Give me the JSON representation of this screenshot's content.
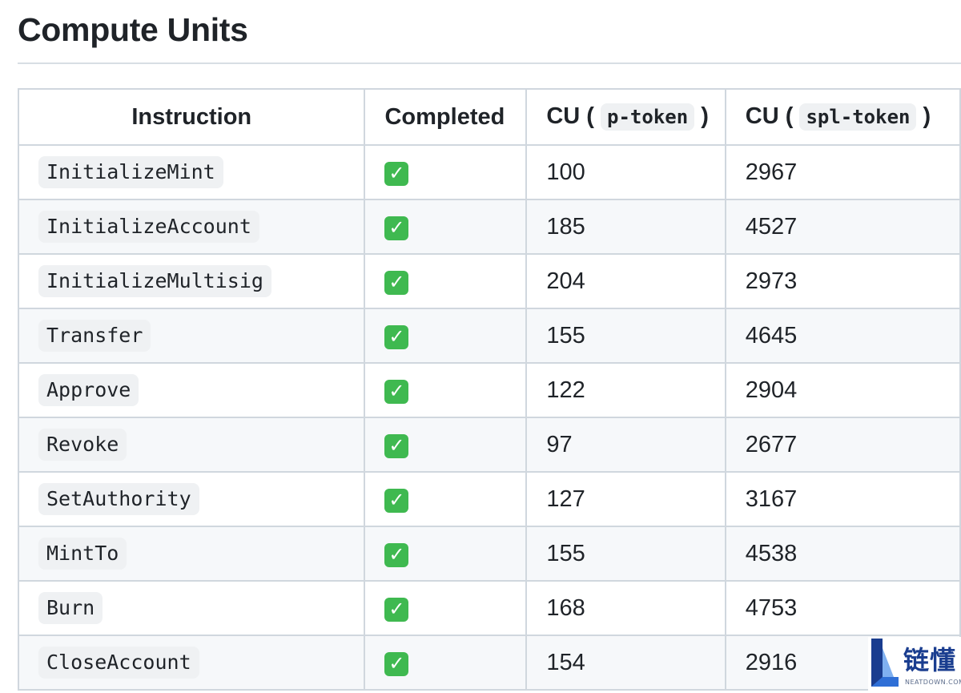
{
  "page": {
    "title": "Compute Units"
  },
  "table": {
    "headers": {
      "instruction": "Instruction",
      "completed": "Completed",
      "cu_prefix": "CU (",
      "cu_suffix": ")",
      "p_token": "p-token",
      "spl_token": "spl-token"
    },
    "check_icon": "white-check-mark-icon",
    "rows": [
      {
        "instruction": "InitializeMint",
        "completed": "✓",
        "p_token": "100",
        "spl_token": "2967"
      },
      {
        "instruction": "InitializeAccount",
        "completed": "✓",
        "p_token": "185",
        "spl_token": "4527"
      },
      {
        "instruction": "InitializeMultisig",
        "completed": "✓",
        "p_token": "204",
        "spl_token": "2973"
      },
      {
        "instruction": "Transfer",
        "completed": "✓",
        "p_token": "155",
        "spl_token": "4645"
      },
      {
        "instruction": "Approve",
        "completed": "✓",
        "p_token": "122",
        "spl_token": "2904"
      },
      {
        "instruction": "Revoke",
        "completed": "✓",
        "p_token": "97",
        "spl_token": "2677"
      },
      {
        "instruction": "SetAuthority",
        "completed": "✓",
        "p_token": "127",
        "spl_token": "3167"
      },
      {
        "instruction": "MintTo",
        "completed": "✓",
        "p_token": "155",
        "spl_token": "4538"
      },
      {
        "instruction": "Burn",
        "completed": "✓",
        "p_token": "168",
        "spl_token": "4753"
      },
      {
        "instruction": "CloseAccount",
        "completed": "✓",
        "p_token": "154",
        "spl_token": "2916"
      }
    ]
  },
  "watermark": {
    "brand": "链懂",
    "site": "NEATDOWN.COM",
    "color": "#1a3d8f"
  }
}
